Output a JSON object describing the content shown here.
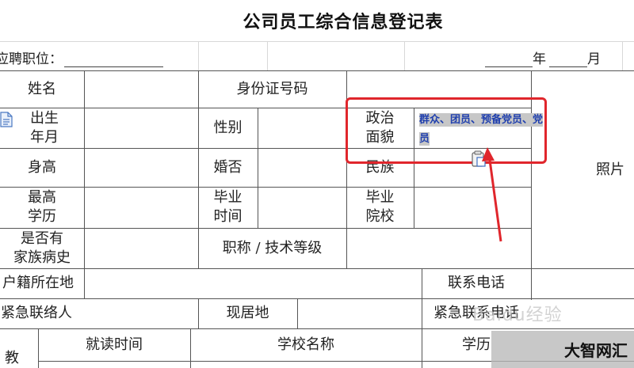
{
  "document": {
    "title": "公司员工综合信息登记表",
    "apply_label": "应聘职位：",
    "date_year": "年",
    "date_month": "月"
  },
  "table": {
    "name": "姓名",
    "id_number": "身份证号码",
    "birth": "出生\n年月",
    "gender": "性别",
    "political": "政治\n面貌",
    "political_value": "群众、团员、预备党员、党员",
    "height": "身高",
    "marital": "婚否",
    "ethnicity": "民族",
    "photo": "照片",
    "education": "最高\n学历",
    "grad_time": "毕业\n时间",
    "grad_school": "毕业\n院校",
    "family_history": "是否有\n家族病史",
    "title_grade": "职称 / 技术等级",
    "household": "户籍所在地",
    "phone": "联系电话",
    "emergency_contact": "紧急联络人",
    "residence": "现居地",
    "emergency_phone": "紧急联系电话",
    "edu_section": "教",
    "study_time": "就读时间",
    "school_name": "学校名称",
    "degree": "学历"
  },
  "overlay": {
    "watermark": "Baidu经验",
    "brand": "大智网汇",
    "highlight_color": "#e0262c",
    "text_color": "#1f3fae"
  }
}
